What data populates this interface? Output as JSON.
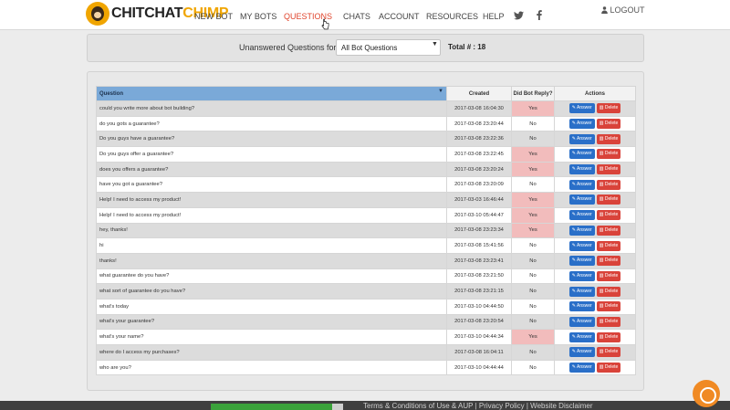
{
  "brand": {
    "part1": "CHITCHAT",
    "part2": "CHIMP"
  },
  "nav": [
    {
      "label": "NEW BOT",
      "active": false
    },
    {
      "label": "MY BOTS",
      "active": false
    },
    {
      "label": "QUESTIONS",
      "active": true
    },
    {
      "label": "CHATS",
      "active": false
    },
    {
      "label": "ACCOUNT",
      "active": false
    },
    {
      "label": "RESOURCES",
      "active": false
    },
    {
      "label": "HELP",
      "active": false
    }
  ],
  "logout_label": "LOGOUT",
  "filter": {
    "label": "Unanswered Questions for :",
    "selected": "All Bot Questions",
    "total_label": "Total # : 18"
  },
  "table": {
    "headers": {
      "question": "Question",
      "created": "Created",
      "did_reply": "Did Bot Reply?",
      "actions": "Actions"
    },
    "answer_label": "Answer",
    "delete_label": "Delete",
    "rows": [
      {
        "q": "could you write more about bot building?",
        "created": "2017-03-08 16:04:30",
        "reply": "Yes"
      },
      {
        "q": "do you gots a guarantee?",
        "created": "2017-03-08 23:20:44",
        "reply": "No"
      },
      {
        "q": "Do you guys have a guarantee?",
        "created": "2017-03-08 23:22:36",
        "reply": "No"
      },
      {
        "q": "Do you guys offer a guarantee?",
        "created": "2017-03-08 23:22:45",
        "reply": "Yes"
      },
      {
        "q": "does you offers a guarantee?",
        "created": "2017-03-08 23:20:24",
        "reply": "Yes"
      },
      {
        "q": "have you got a guarantee?",
        "created": "2017-03-08 23:20:09",
        "reply": "No"
      },
      {
        "q": "Help! I need to access my product!",
        "created": "2017-03-03 16:46:44",
        "reply": "Yes"
      },
      {
        "q": "Help! I need to access my product!",
        "created": "2017-03-10 05:44:47",
        "reply": "Yes"
      },
      {
        "q": "hey, thanks!",
        "created": "2017-03-08 23:23:34",
        "reply": "Yes"
      },
      {
        "q": "hi",
        "created": "2017-03-08 15:41:56",
        "reply": "No"
      },
      {
        "q": "thanks!",
        "created": "2017-03-08 23:23:41",
        "reply": "No"
      },
      {
        "q": "what guarantee do you have?",
        "created": "2017-03-08 23:21:50",
        "reply": "No"
      },
      {
        "q": "what sort of guarantee do you have?",
        "created": "2017-03-08 23:21:15",
        "reply": "No"
      },
      {
        "q": "what's today",
        "created": "2017-03-10 04:44:50",
        "reply": "No"
      },
      {
        "q": "what's your guarantee?",
        "created": "2017-03-08 23:20:54",
        "reply": "No"
      },
      {
        "q": "what's your name?",
        "created": "2017-03-10 04:44:34",
        "reply": "Yes"
      },
      {
        "q": "where do I access my purchases?",
        "created": "2017-03-08 16:04:11",
        "reply": "No"
      },
      {
        "q": "who are you?",
        "created": "2017-03-10 04:44:44",
        "reply": "No"
      }
    ]
  },
  "footer": {
    "links": "Terms & Conditions of Use & AUP  |  Privacy Policy  |  Website Disclaimer"
  },
  "colors": {
    "accent": "#e0452d",
    "brand": "#f0a500",
    "header_blue": "#7aa9d8",
    "yes_bg": "#f2bcbc",
    "answer_btn": "#2a6fc8",
    "delete_btn": "#d9433a"
  }
}
